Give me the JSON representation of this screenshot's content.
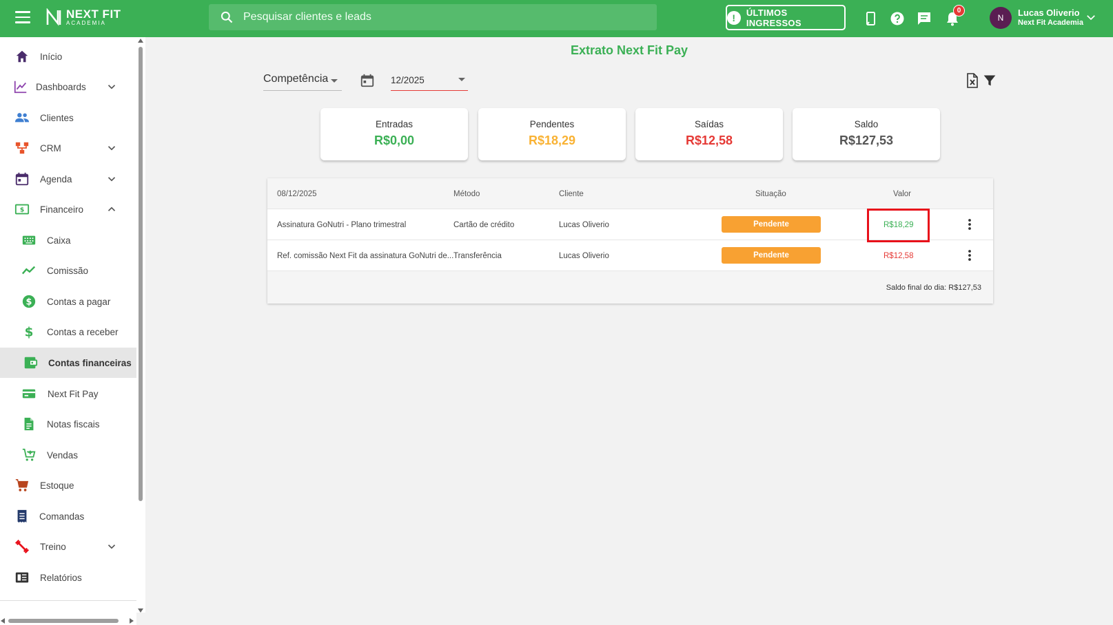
{
  "app": {
    "logo_main": "NEXT FIT",
    "logo_sub": "ACADEMIA",
    "search_placeholder": "Pesquisar clientes e leads",
    "ingressos_label": "ÚLTIMOS INGRESSOS",
    "notification_count": "0",
    "user": {
      "initials": "N",
      "name": "Lucas Oliverio",
      "org": "Next Fit Academia"
    }
  },
  "sidebar": {
    "items": [
      {
        "label": "Início",
        "icon": "home-icon"
      },
      {
        "label": "Dashboards",
        "icon": "chart-icon",
        "expandable": true
      },
      {
        "label": "Clientes",
        "icon": "people-icon"
      },
      {
        "label": "CRM",
        "icon": "crm-icon",
        "expandable": true
      },
      {
        "label": "Agenda",
        "icon": "calendar-icon",
        "expandable": true
      },
      {
        "label": "Financeiro",
        "icon": "money-icon",
        "expanded": true
      },
      {
        "label": "Caixa",
        "icon": "register-icon"
      },
      {
        "label": "Comissão",
        "icon": "trend-icon"
      },
      {
        "label": "Contas a pagar",
        "icon": "dollar-circle-icon"
      },
      {
        "label": "Contas a receber",
        "icon": "dollar-icon"
      },
      {
        "label": "Contas financeiras",
        "icon": "wallet-icon",
        "active": true
      },
      {
        "label": "Next Fit Pay",
        "icon": "card-icon"
      },
      {
        "label": "Notas fiscais",
        "icon": "document-icon"
      },
      {
        "label": "Vendas",
        "icon": "cart-plus-icon"
      },
      {
        "label": "Estoque",
        "icon": "cart-icon"
      },
      {
        "label": "Comandas",
        "icon": "receipt-icon"
      },
      {
        "label": "Treino",
        "icon": "dumbbell-icon",
        "expandable": true
      },
      {
        "label": "Relatórios",
        "icon": "report-icon"
      }
    ]
  },
  "main": {
    "title": "Extrato Next Fit Pay",
    "filter_mode": "Competência",
    "period": "12/2025",
    "cards": [
      {
        "label": "Entradas",
        "value": "R$0,00",
        "color": "#3bb055"
      },
      {
        "label": "Pendentes",
        "value": "R$18,29",
        "color": "#f9b233"
      },
      {
        "label": "Saídas",
        "value": "R$12,58",
        "color": "#e53935"
      },
      {
        "label": "Saldo",
        "value": "R$127,53",
        "color": "#555555"
      }
    ],
    "table": {
      "headers": {
        "date": "08/12/2025",
        "method": "Método",
        "client": "Cliente",
        "status": "Situação",
        "value": "Valor"
      },
      "rows": [
        {
          "description": "Assinatura GoNutri - Plano trimestral",
          "method": "Cartão de crédito",
          "client": "Lucas Oliverio",
          "status": "Pendente",
          "value": "R$18,29",
          "value_color": "#3bb055"
        },
        {
          "description": "Ref. comissão Next Fit da assinatura GoNutri de...",
          "method": "Transferência",
          "client": "Lucas Oliverio",
          "status": "Pendente",
          "value": "R$12,58",
          "value_color": "#e53935"
        }
      ],
      "footer": "Saldo final do dia: R$127,53"
    }
  },
  "colors": {
    "brand": "#3bb055",
    "pending": "#f8a132",
    "danger": "#e53935",
    "highlight": "#e8101a"
  }
}
